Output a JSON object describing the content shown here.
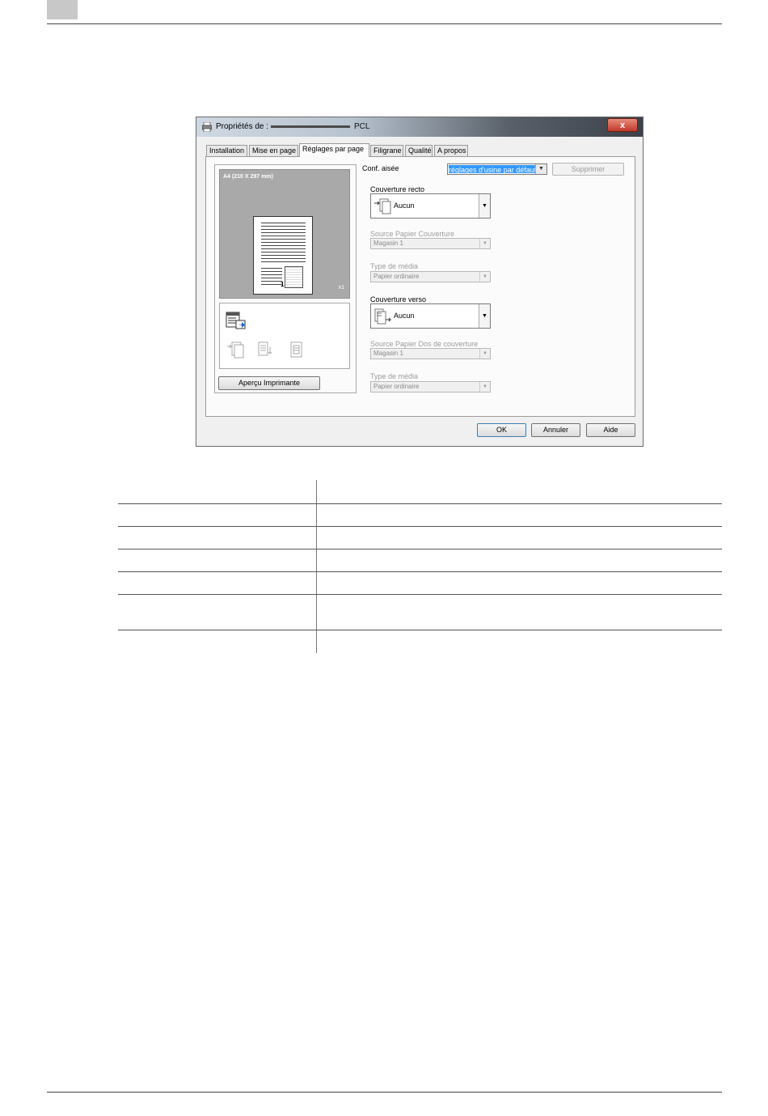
{
  "dialog": {
    "title": "Propriétés de :",
    "title_suffix": "PCL",
    "close_label": "x",
    "tabs": [
      {
        "label": "Installation"
      },
      {
        "label": "Mise en page"
      },
      {
        "label": "Réglages par page"
      },
      {
        "label": "Filigrane"
      },
      {
        "label": "Qualité"
      },
      {
        "label": "A propos"
      }
    ],
    "preview": {
      "paper_label": "A4  (210 X 297 mm)",
      "copies": "x1",
      "page_number": "1"
    },
    "apercu_button": "Aperçu Imprimante",
    "conf": {
      "label": "Conf. aisée",
      "selected": "réglages d'usine par défaut",
      "delete_button": "Supprimer"
    },
    "front_cover": {
      "label": "Couverture recto",
      "value": "Aucun",
      "source_label": "Source Papier Couverture",
      "source_value": "Magasin 1",
      "media_label": "Type de média",
      "media_value": "Papier ordinaire"
    },
    "back_cover": {
      "label": "Couverture verso",
      "value": "Aucun",
      "source_label": "Source Papier Dos de couverture",
      "source_value": "Magasin 1",
      "media_label": "Type de média",
      "media_value": "Papier ordinaire"
    },
    "buttons": {
      "ok": "OK",
      "cancel": "Annuler",
      "help": "Aide"
    }
  }
}
